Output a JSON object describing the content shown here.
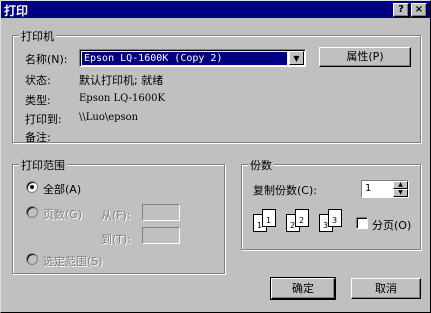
{
  "window": {
    "title": "打印",
    "help_label": "?",
    "close_label": "×"
  },
  "printer": {
    "group_label": "打印机",
    "name_label": "名称(N):",
    "name_value": "Epson LQ-1600K (Copy 2)",
    "properties_label": "属性(P)",
    "status_label": "状态:",
    "status_value": "默认打印机; 就绪",
    "type_label": "类型:",
    "type_value": "Epson LQ-1600K",
    "where_label": "打印到:",
    "where_value": "\\\\Luo\\epson",
    "comment_label": "备注:"
  },
  "range": {
    "group_label": "打印范围",
    "all_label": "全部(A)",
    "pages_label": "页数(G)",
    "from_label": "从(F):",
    "to_label": "到(T):",
    "selection_label": "选定范围(S)"
  },
  "copies": {
    "group_label": "份数",
    "count_label": "复制份数(C):",
    "count_value": "1",
    "collate_label": "分页(O)",
    "collate_checked": false,
    "pages": [
      "1",
      "1",
      "2",
      "2",
      "3",
      "3"
    ]
  },
  "buttons": {
    "ok": "确定",
    "cancel": "取消"
  }
}
